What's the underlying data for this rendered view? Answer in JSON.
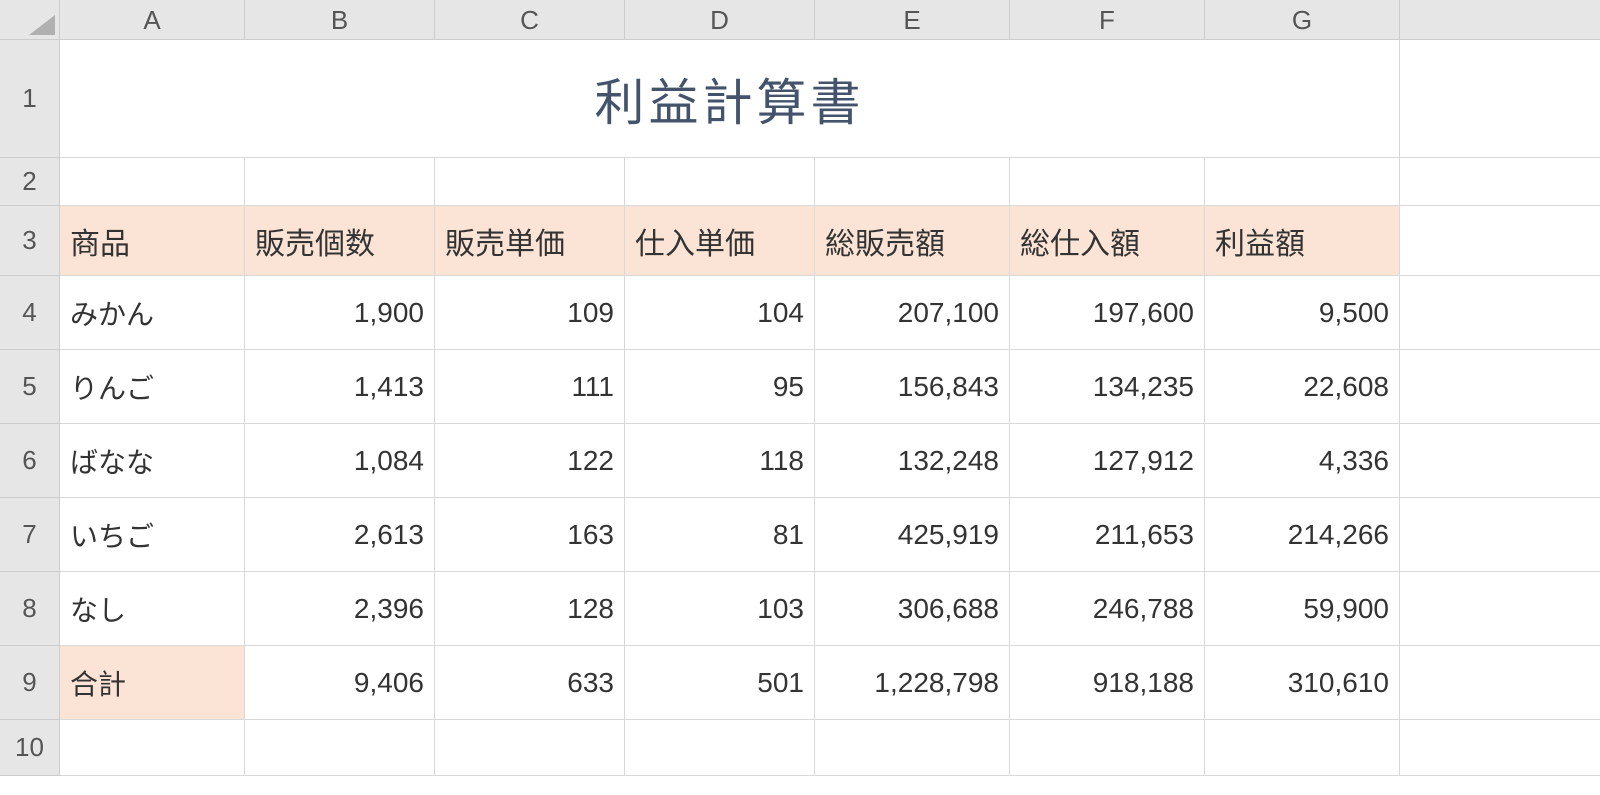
{
  "columns": [
    "A",
    "B",
    "C",
    "D",
    "E",
    "F",
    "G"
  ],
  "rows": [
    "1",
    "2",
    "3",
    "4",
    "5",
    "6",
    "7",
    "8",
    "9",
    "10"
  ],
  "title": "利益計算書",
  "headers": {
    "a": "商品",
    "b": "販売個数",
    "c": "販売単価",
    "d": "仕入単価",
    "e": "総販売額",
    "f": "総仕入額",
    "g": "利益額"
  },
  "data": [
    {
      "a": "みかん",
      "b": "1,900",
      "c": "109",
      "d": "104",
      "e": "207,100",
      "f": "197,600",
      "g": "9,500"
    },
    {
      "a": "りんご",
      "b": "1,413",
      "c": "111",
      "d": "95",
      "e": "156,843",
      "f": "134,235",
      "g": "22,608"
    },
    {
      "a": "ばなな",
      "b": "1,084",
      "c": "122",
      "d": "118",
      "e": "132,248",
      "f": "127,912",
      "g": "4,336"
    },
    {
      "a": "いちご",
      "b": "2,613",
      "c": "163",
      "d": "81",
      "e": "425,919",
      "f": "211,653",
      "g": "214,266"
    },
    {
      "a": "なし",
      "b": "2,396",
      "c": "128",
      "d": "103",
      "e": "306,688",
      "f": "246,788",
      "g": "59,900"
    }
  ],
  "total": {
    "a": "合計",
    "b": "9,406",
    "c": "633",
    "d": "501",
    "e": "1,228,798",
    "f": "918,188",
    "g": "310,610"
  }
}
